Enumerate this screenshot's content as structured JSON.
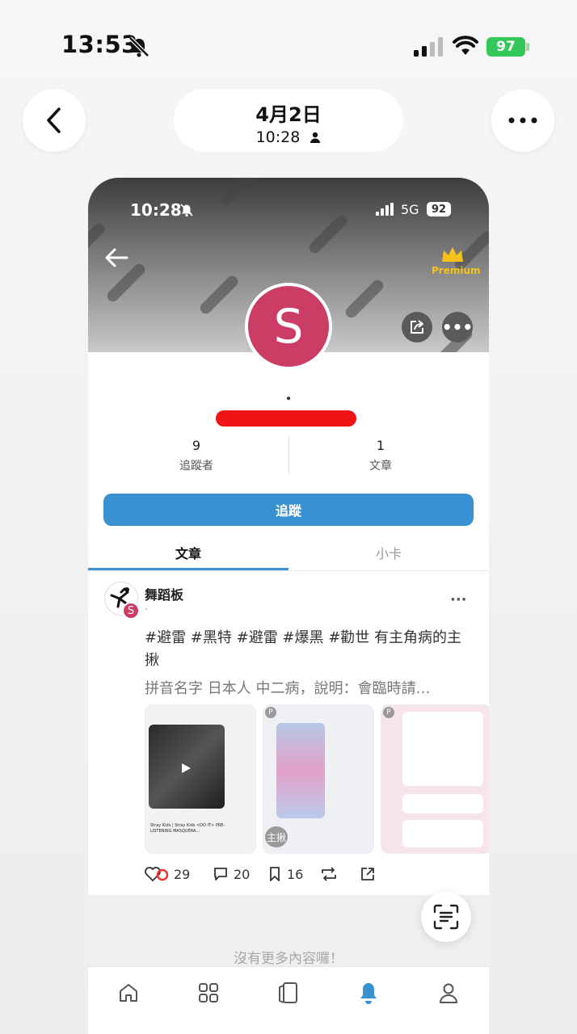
{
  "status_bar": {
    "time": "13:53",
    "battery": "97"
  },
  "header": {
    "date": "4月2日",
    "time": "10:28"
  },
  "inner_status": {
    "time": "10:28",
    "network": "5G",
    "battery": "92"
  },
  "profile": {
    "badge": "Premium",
    "avatar_letter": "S",
    "stats": [
      {
        "value": "9",
        "label": "追蹤者"
      },
      {
        "value": "1",
        "label": "文章"
      }
    ],
    "follow_label": "追蹤"
  },
  "tabs": [
    {
      "label": "文章",
      "active": true
    },
    {
      "label": "小卡",
      "active": false
    }
  ],
  "post": {
    "avatar_letter": "S",
    "board": "舞蹈板",
    "subtitle": "·",
    "tags": "#避雷 #黑特 #避雷 #爆黑 #勸世 有主角病的主揪",
    "preview": "拼音名字 日本人 中二病，說明：會臨時請…",
    "thumb1_caption": "Stray Kids | Stray Kids <DO IT> PRE-LISTENING MASQUERA...",
    "thumb2_label": "主揪",
    "thumb_badge": "P",
    "likes": "29",
    "comments": "20",
    "bookmarks": "16"
  },
  "feed_end": "沒有更多內容囉！",
  "colors": {
    "accent": "#3a91d2",
    "avatar": "#cc3d66",
    "premium": "#f4c21b",
    "battery": "#34c759"
  }
}
